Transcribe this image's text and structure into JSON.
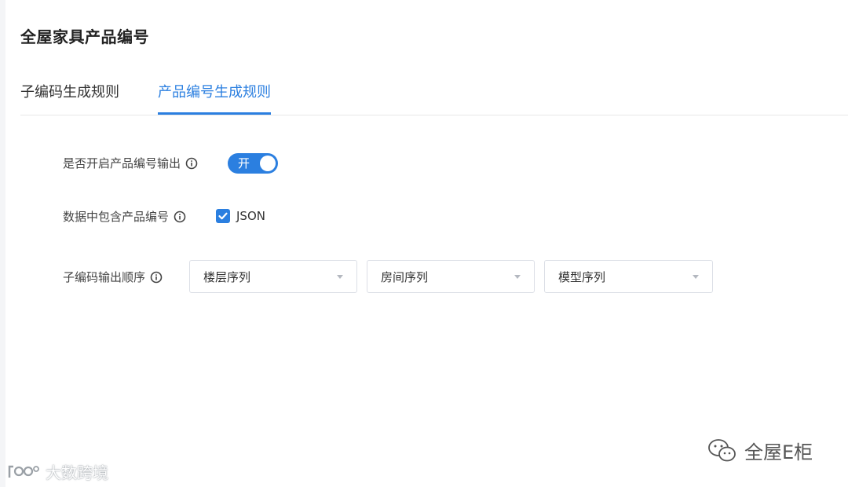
{
  "page": {
    "title": "全屋家具产品编号"
  },
  "tabs": [
    {
      "label": "子编码生成规则",
      "active": false
    },
    {
      "label": "产品编号生成规则",
      "active": true
    }
  ],
  "settings": {
    "enable_output": {
      "label": "是否开启产品编号输出",
      "toggle_text": "开",
      "on": true
    },
    "include_in_data": {
      "label": "数据中包含产品编号",
      "checkbox_label": "JSON",
      "checked": true
    },
    "order": {
      "label": "子编码输出顺序",
      "selects": [
        {
          "value": "楼层序列"
        },
        {
          "value": "房间序列"
        },
        {
          "value": "模型序列"
        }
      ]
    }
  },
  "watermarks": {
    "left_text": "大数跨境",
    "right_text": "全屋E柜"
  },
  "colors": {
    "accent": "#2b7fe0",
    "text": "#333333",
    "border": "#dcdfe6"
  },
  "icons": {
    "info": "info-circle-icon",
    "check": "checkmark-icon",
    "dropdown": "caret-down-icon",
    "wechat": "wechat-icon"
  }
}
